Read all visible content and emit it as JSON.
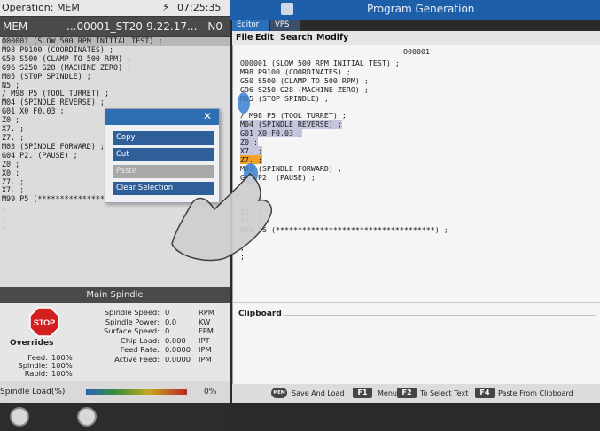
{
  "status": {
    "operation": "Operation: MEM",
    "time": "07:25:35"
  },
  "mem_header": {
    "mode": "MEM",
    "file": "...00001_ST20-9.22.17...",
    "n": "N0"
  },
  "left_code": [
    "O00001 (SLOW 500 RPM INITIAL TEST) ;",
    "M98 P9100 (COORDINATES) ;",
    "G50 S500 (CLAMP TO 500 RPM) ;",
    "G96 S250 G28 (MACHINE ZERO) ;",
    "M05 (STOP SPINDLE) ;",
    "N5 ;",
    "/ M98 P5 (TOOL TURRET) ;",
    "M04 (SPINDLE REVERSE) ;",
    "G01 X0 F0.03 ;",
    "Z0 ;",
    "X7. ;",
    "Z7. ;",
    "M03 (SPINDLE FORWARD) ;",
    "G04 P2. (PAUSE) ;",
    "Z0 ;",
    "X0 ;",
    "Z7. ;",
    "X7. ;",
    "M99 P5 (************************************) ;",
    ";",
    ";",
    ";"
  ],
  "context_menu": {
    "close": "✕",
    "items": [
      "Copy",
      "Cut",
      "Paste",
      "Clear Selection"
    ]
  },
  "spindle": {
    "title": "Main Spindle",
    "stop_label": "STOP",
    "overrides_title": "Overrides",
    "overrides": [
      {
        "label": "Feed:",
        "value": "100%"
      },
      {
        "label": "Spindle:",
        "value": "100%"
      },
      {
        "label": "Rapid:",
        "value": "100%"
      }
    ],
    "rows": [
      {
        "label": "Spindle Speed:",
        "value": "0",
        "unit": "RPM"
      },
      {
        "label": "Spindle Power:",
        "value": "0.0",
        "unit": "KW"
      },
      {
        "label": "Surface Speed:",
        "value": "0",
        "unit": "FPM"
      },
      {
        "label": "Chip Load:",
        "value": "0.000",
        "unit": "IPT"
      },
      {
        "label": "Feed Rate:",
        "value": "0.0000",
        "unit": "IPM"
      },
      {
        "label": "Active Feed:",
        "value": "0.0000",
        "unit": "IPM"
      }
    ],
    "load_label": "Spindle Load(%)",
    "load_value": "0%",
    "load_fraction": 0.0
  },
  "program_gen": {
    "title": "Program Generation",
    "tabs": [
      "Editor",
      "VPS"
    ],
    "menu": [
      "File",
      "Edit",
      "Search",
      "Modify"
    ],
    "program_number": "O00001",
    "lines": [
      {
        "text": "O00001 (SLOW 500 RPM INITIAL TEST) ;",
        "state": ""
      },
      {
        "text": "M98 P9100 (COORDINATES) ;",
        "state": ""
      },
      {
        "text": "G50 S500 (CLAMP TO 500 RPM) ;",
        "state": ""
      },
      {
        "text": "G96 S250 G28 (MACHINE ZERO) ;",
        "state": ""
      },
      {
        "text": "M05 (STOP SPINDLE) ;",
        "state": ""
      },
      {
        "text": "",
        "state": ""
      },
      {
        "text": "/ M98 P5 (TOOL TURRET) ;",
        "state": ""
      },
      {
        "text": "M04 (SPINDLE REVERSE) ;",
        "state": "sel"
      },
      {
        "text": "G01 X0 F0.03 ;",
        "state": "sel"
      },
      {
        "text": "Z0 ;",
        "state": "sel"
      },
      {
        "text": "X7. ;",
        "state": "sel"
      },
      {
        "text": "Z7. ;",
        "state": "cur"
      },
      {
        "text": "M03 (SPINDLE FORWARD) ;",
        "state": ""
      },
      {
        "text": "G04 P2. (PAUSE) ;",
        "state": ""
      },
      {
        "text": "",
        "state": ""
      },
      {
        "text": "",
        "state": ""
      },
      {
        "text": "",
        "state": ""
      },
      {
        "text": "Z7. ;",
        "state": ""
      },
      {
        "text": "X7. ;",
        "state": ""
      },
      {
        "text": "M99 P5 (************************************) ;",
        "state": ""
      },
      {
        "text": ";",
        "state": ""
      },
      {
        "text": ";",
        "state": ""
      },
      {
        "text": ";",
        "state": ""
      }
    ],
    "clipboard_label": "Clipboard"
  },
  "hints": [
    {
      "key": "MEM",
      "text": "Save And Load"
    },
    {
      "key": "F1",
      "text": "Menu"
    },
    {
      "key": "F2",
      "text": "To Select Text"
    },
    {
      "key": "F4",
      "text": "Paste From Clipboard"
    }
  ],
  "colors": {
    "accent": "#1d5fa8",
    "selection": "#c5c5dc",
    "cursor_line": "#f2a12a",
    "stop_red": "#d22020"
  }
}
